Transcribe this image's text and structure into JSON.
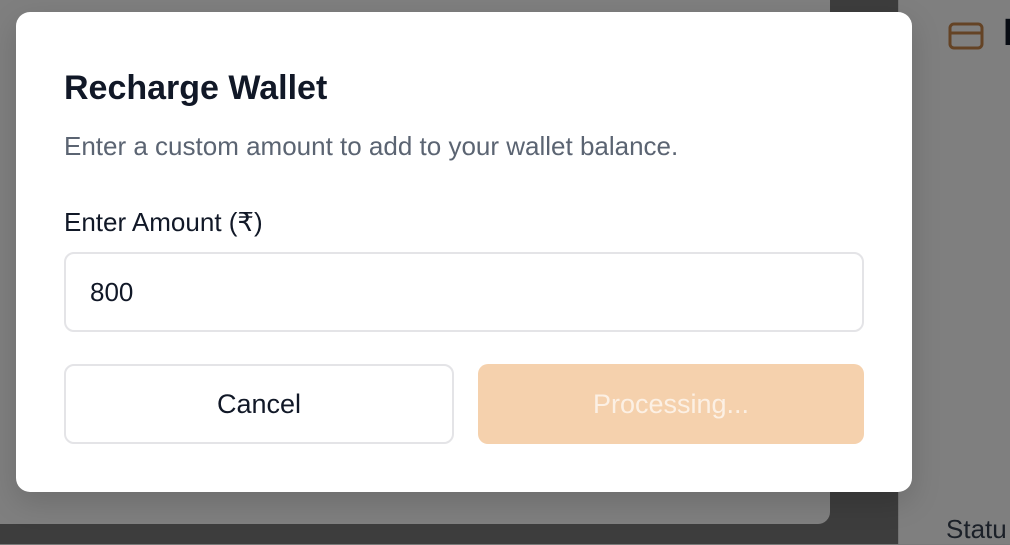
{
  "background": {
    "card_icon": "credit-card-icon",
    "heading_partial": "I",
    "status_partial": "Statu"
  },
  "modal": {
    "title": "Recharge Wallet",
    "description": "Enter a custom amount to add to your wallet balance.",
    "amount_label": "Enter Amount (₹)",
    "amount_value": "800",
    "cancel_label": "Cancel",
    "submit_label": "Processing..."
  },
  "colors": {
    "accent": "#f5d1ad",
    "accent_icon": "#c9864a",
    "overlay": "rgba(0,0,0,0.5)"
  }
}
